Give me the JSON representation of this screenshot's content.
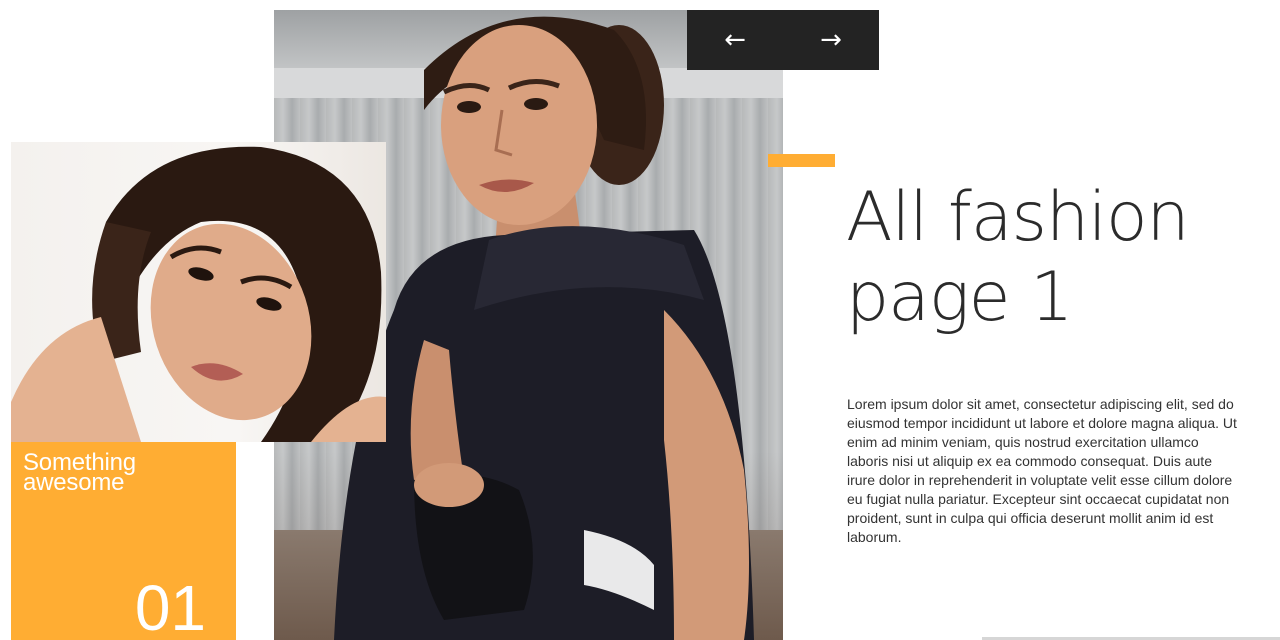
{
  "colors": {
    "accent": "#ffad33",
    "nav_background": "#232323",
    "heading": "#2b2b2b",
    "body_text": "#333333"
  },
  "slider": {
    "prev_icon": "arrow-left-icon",
    "prev_glyph": "←",
    "next_icon": "arrow-right-icon",
    "next_glyph": "→",
    "progress_fraction": 0.0
  },
  "caption": {
    "title": "Something awesome",
    "number": "01"
  },
  "content": {
    "heading_line1": "All fashion",
    "heading_line2": "page 1",
    "body": "Lorem ipsum dolor sit amet, consectetur adipiscing elit, sed do eiusmod tempor incididunt ut labore et dolore magna aliqua. Ut enim ad minim veniam, quis nostrud exercitation ullamco laboris nisi ut aliquip ex ea commodo consequat. Duis aute irure dolor in reprehenderit in voluptate velit esse cillum dolore eu fugiat nulla pariatur. Excepteur sint occaecat cupidatat non proident, sunt in culpa qui officia deserunt mollit anim id est laborum."
  }
}
